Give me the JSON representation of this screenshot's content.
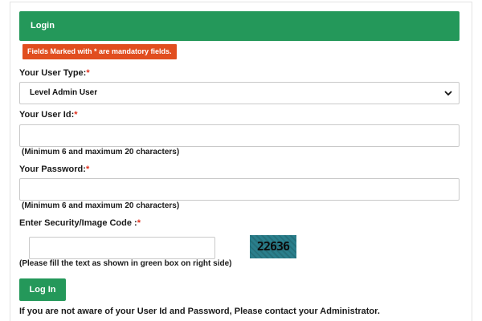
{
  "header": {
    "title": "Login"
  },
  "notice": {
    "text": "Fields Marked with * are mandatory fields."
  },
  "user_type": {
    "label": "Your User Type:",
    "required_mark": "*",
    "selected": "Level Admin User"
  },
  "user_id": {
    "label": "Your User Id:",
    "required_mark": "*",
    "value": "",
    "hint": "(Minimum 6 and maximum 20 characters)"
  },
  "password": {
    "label": "Your Password:",
    "required_mark": "*",
    "value": "",
    "hint": "(Minimum 6 and maximum 20 characters)"
  },
  "security": {
    "label": "Enter Security/Image Code :",
    "required_mark": "*",
    "value": "",
    "captcha_text": "22636",
    "hint": "(Please fill the text as shown in green box on right side)"
  },
  "login_button": {
    "label": "Log In"
  },
  "footer": {
    "note": "If you are not aware of your User Id and Password, Please contact your Administrator."
  },
  "colors": {
    "header_green": "#24985a",
    "notice_orange": "#e14e1f",
    "required_red": "#e0301e",
    "captcha_teal": "#2a7f8c"
  }
}
